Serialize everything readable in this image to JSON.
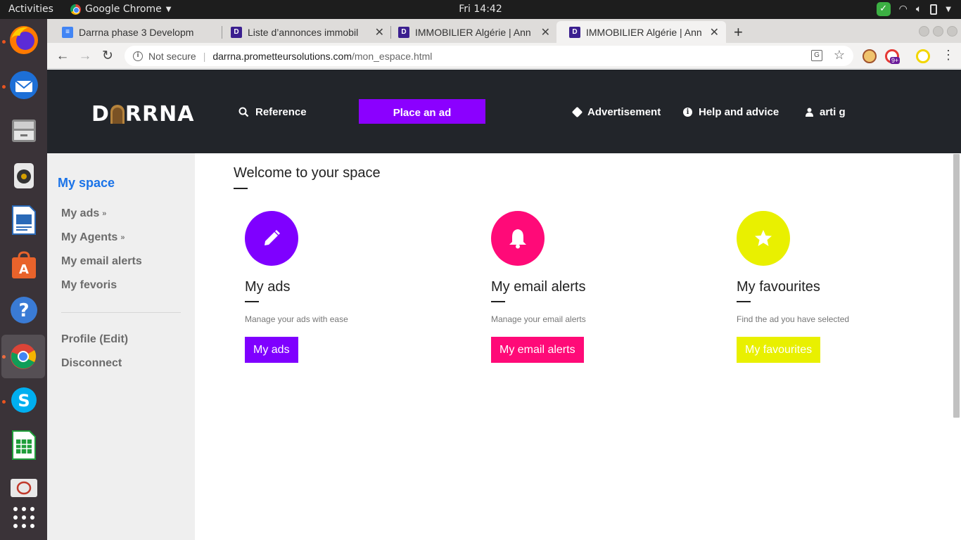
{
  "system": {
    "activities": "Activities",
    "app_name": "Google Chrome",
    "clock": "Fri 14:42"
  },
  "tabs": [
    {
      "title": "Darrna phase 3 Developm",
      "favicon": "docs-icon",
      "color": "#4285f4"
    },
    {
      "title": "Liste d’annonces immobil",
      "favicon": "D",
      "color": "#3b1f8f"
    },
    {
      "title": "IMMOBILIER Algérie | Ann",
      "favicon": "D",
      "color": "#3b1f8f"
    },
    {
      "title": "IMMOBILIER Algérie | Ann",
      "favicon": "D",
      "color": "#3b1f8f"
    }
  ],
  "omnibox": {
    "security": "Not secure",
    "host": "darrna.prometteursolutions.com",
    "path": "/mon_espace.html"
  },
  "extensions": {
    "badge": "9+"
  },
  "header": {
    "logo_left": "D",
    "logo_right": "RRNA",
    "reference": "Reference",
    "place_ad": "Place an ad",
    "advertisement": "Advertisement",
    "help": "Help and advice",
    "user": "arti g"
  },
  "sidebar": {
    "heading": "My space",
    "links": [
      "My ads",
      "My Agents",
      "My email alerts",
      "My fevoris"
    ],
    "profile": "Profile (Edit)",
    "disconnect": "Disconnect"
  },
  "main": {
    "welcome": "Welcome to your space",
    "cards": [
      {
        "title": "My ads",
        "desc": "Manage your ads with ease",
        "button": "My ads",
        "icon": "pencil-icon",
        "color": "#7f00ff"
      },
      {
        "title": "My email alerts",
        "desc": "Manage your email alerts",
        "button": "My email alerts",
        "icon": "bell-icon",
        "color": "#ff0a78"
      },
      {
        "title": "My favourites",
        "desc": "Find the ad you have selected",
        "button": "My favourites",
        "icon": "star-icon",
        "color": "#e9f000"
      }
    ]
  },
  "colors": {
    "header_bg": "#22252a",
    "accent_purple": "#8b00ff",
    "link_blue": "#1a73e8"
  }
}
